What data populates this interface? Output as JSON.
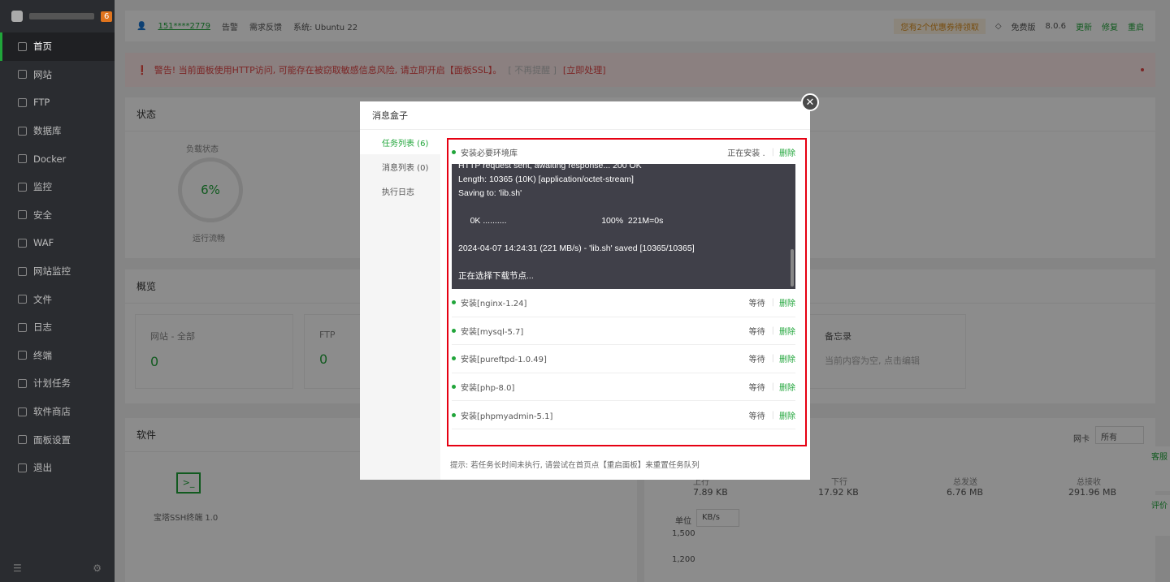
{
  "brand": {
    "badge": "6"
  },
  "sidebar": {
    "items": [
      {
        "label": "首页"
      },
      {
        "label": "网站"
      },
      {
        "label": "FTP"
      },
      {
        "label": "数据库"
      },
      {
        "label": "Docker"
      },
      {
        "label": "监控"
      },
      {
        "label": "安全"
      },
      {
        "label": "WAF"
      },
      {
        "label": "网站监控"
      },
      {
        "label": "文件"
      },
      {
        "label": "日志"
      },
      {
        "label": "终端"
      },
      {
        "label": "计划任务"
      },
      {
        "label": "软件商店"
      },
      {
        "label": "面板设置"
      },
      {
        "label": "退出"
      }
    ]
  },
  "topbar": {
    "user": "151****2779",
    "alert": "告警",
    "feedback": "需求反馈",
    "system": "系统: Ubuntu 22",
    "coupon": "您有2个优惠券待领取",
    "edition": "免费版",
    "version": "8.0.6",
    "update": "更新",
    "repair": "修复",
    "restart": "重启"
  },
  "warning": {
    "text": "警告! 当前面板使用HTTP访问, 可能存在被窃取敏感信息风险, 请立即开启【面板SSL】。",
    "ignore": "[ 不再提醒 ]",
    "action": "[立即处理]"
  },
  "status": {
    "title": "状态",
    "load_label": "负载状态",
    "load_value": "6%",
    "load_sub": "运行流畅"
  },
  "overview": {
    "title": "概览",
    "cards": [
      {
        "label": "网站 - 全部",
        "value": "0"
      },
      {
        "label": "FTP",
        "value": "0"
      },
      {
        "label": "备忘录",
        "value": "当前内容为空, 点击编辑"
      }
    ]
  },
  "software": {
    "title": "软件",
    "ssh": "宝塔SSH终端 1.0"
  },
  "traffic": {
    "nic_label": "网卡",
    "nic_value": "所有",
    "up_label": "上行",
    "up_value": "7.89 KB",
    "down_label": "下行",
    "down_value": "17.92 KB",
    "sent_label": "总发送",
    "sent_value": "6.76 MB",
    "recv_label": "总接收",
    "recv_value": "291.96 MB",
    "unit_label": "单位",
    "unit_value": "KB/s",
    "y1": "1,500",
    "y2": "1,200"
  },
  "modal": {
    "title": "消息盒子",
    "tabs": [
      {
        "label": "任务列表 (6)"
      },
      {
        "label": "消息列表 (0)"
      },
      {
        "label": "执行日志"
      }
    ],
    "tasks": [
      {
        "name": "安装必要环境库",
        "status": "正在安装 .",
        "action": "删除"
      },
      {
        "name": "安装[nginx-1.24]",
        "status": "等待",
        "action": "删除"
      },
      {
        "name": "安装[mysql-5.7]",
        "status": "等待",
        "action": "删除"
      },
      {
        "name": "安装[pureftpd-1.0.49]",
        "status": "等待",
        "action": "删除"
      },
      {
        "name": "安装[php-8.0]",
        "status": "等待",
        "action": "删除"
      },
      {
        "name": "安装[phpmyadmin-5.1]",
        "status": "等待",
        "action": "删除"
      }
    ],
    "log_lines": [
      "HTTP request sent, awaiting response... 200 OK",
      "Length: 10365 (10K) [application/octet-stream]",
      "Saving to: 'lib.sh'",
      "",
      "     0K ..........                                        100%  221M=0s",
      "",
      "2024-04-07 14:24:31 (221 MB/s) - 'lib.sh' saved [10365/10365]",
      "",
      "正在选择下载节点..."
    ],
    "hint": "提示: 若任务长时间未执行, 请尝试在首页点【重启面板】来重置任务队列"
  },
  "side_tabs": {
    "service": "客服",
    "rate": "评价"
  }
}
